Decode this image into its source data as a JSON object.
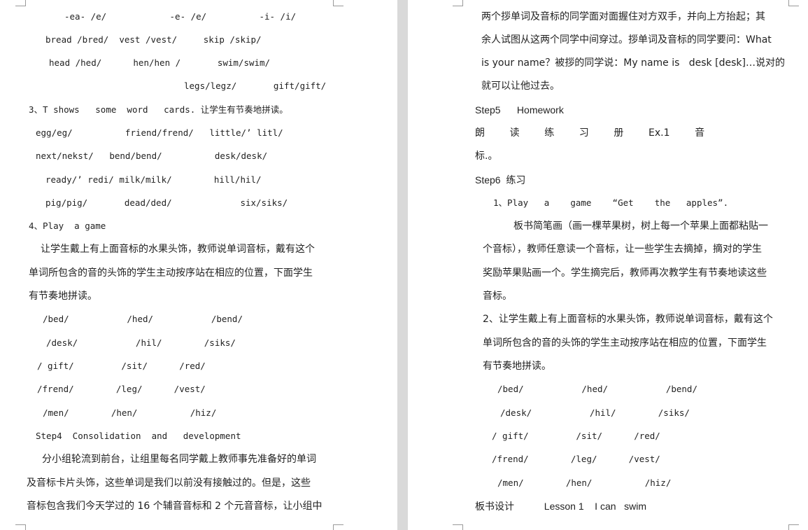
{
  "left_page": {
    "lines": [
      "-ea- /e/            -e- /e/          -i- /i/",
      "bread /bred/  vest /vest/     skip /skip/",
      "head /hed/      hen/hen /       swim/swim/",
      "legs/legz/       gift/gift/",
      "3、T shows   some  word   cards. 让学生有节奏地拼读。",
      "egg/eg/          friend/frend/   little/’ litl/",
      "next/nekst/   bend/bend/          desk/desk/",
      "ready/’ redi/ milk/milk/        hill/hil/",
      "pig/pig/       dead/ded/             six/siks/",
      "4、Play  a game",
      "让学生戴上有上面音标的水果头饰，教师说单词音标，戴有这个",
      "单词所包含的音的头饰的学生主动按序站在相应的位置，下面学生",
      "有节奏地拼读。",
      "/bed/           /hed/           /bend/",
      "/desk/           /hil/        /siks/",
      "/ gift/         /sit/      /red/",
      "/frend/        /leg/      /vest/",
      "/men/        /hen/          /hiz/",
      "Step4  Consolidation  and   development",
      "分小组轮流到前台，让组里每名同学戴上教师事先准备好的单词",
      "及音标卡片头饰，这些单词是我们以前没有接触过的。但是，这些",
      "音标包含我们今天学过的 16 个辅音音标和 2 个元音音标，让小组中"
    ]
  },
  "right_page": {
    "lines": [
      "两个拶单词及音标的同学面对面握住对方双手，并向上方抬起；其",
      "余人试图从这两个同学中间穿过。拶单词及音标的同学要问：What",
      "is your name？被拶的同学说：My name is   desk [desk]…说对的",
      "就可以让他过去。",
      "Step5      Homework",
      "朗        读        练        习        册        Ex.1        音",
      "标.。",
      "Step6  练习",
      "1、Play   a    game    “Get    the   apples”.",
      "板书简笔画（画一棵苹果树，树上每一个苹果上面都粘贴一",
      "个音标），教师任意读一个音标，让一些学生去摘掉，摘对的学生",
      "奖励苹果贴画一个。学生摘完后，教师再次教学生有节奏地读这些",
      "音标。",
      "2、让学生戴上有上面音标的水果头饰，教师说单词音标，戴有这个",
      "单词所包含的音的头饰的学生主动按序站在相应的位置，下面学生",
      "有节奏地拼读。",
      "/bed/           /hed/           /bend/",
      "/desk/           /hil/        /siks/",
      "/ gift/         /sit/      /red/",
      "/frend/        /leg/      /vest/",
      "/men/        /hen/          /hiz/",
      "板书设计           Lesson 1    I can   swim"
    ]
  }
}
